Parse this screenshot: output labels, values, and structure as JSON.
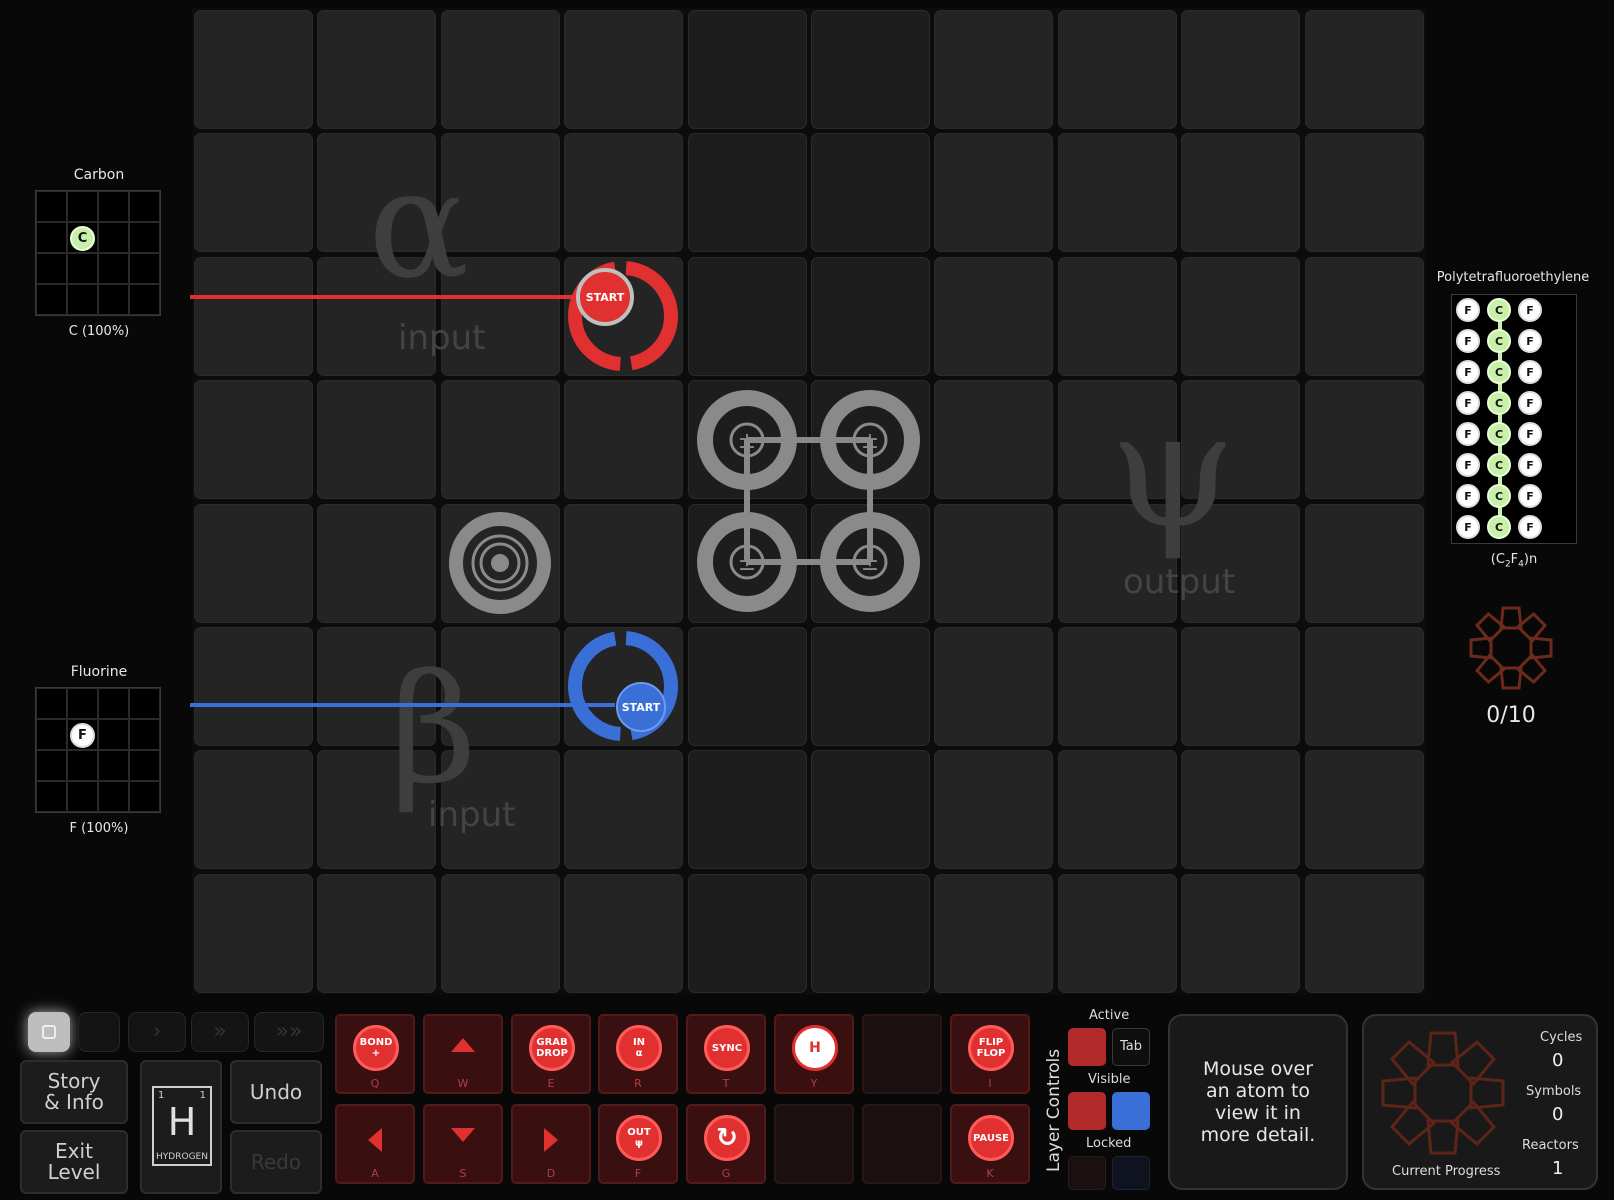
{
  "inputs": [
    {
      "name": "Carbon",
      "symbol": "C",
      "percent": "C (100%)"
    },
    {
      "name": "Fluorine",
      "symbol": "F",
      "percent": "F (100%)"
    }
  ],
  "zones": {
    "alpha": {
      "symbol": "α",
      "label": "input"
    },
    "beta": {
      "symbol": "β",
      "label": "input"
    },
    "psi": {
      "symbol": "ψ",
      "label": "output"
    }
  },
  "waldos": {
    "red_start": "START",
    "blue_start": "START"
  },
  "colors": {
    "red": "#e03030",
    "blue": "#3a6fd8",
    "carbon": "#c9f0a8",
    "fluorine": "#ffffff"
  },
  "output": {
    "name": "Polytetrafluoroethylene",
    "formula_base": "(C",
    "formula_sub1": "2",
    "formula_mid": "F",
    "formula_sub2": "4",
    "formula_tail": ")n",
    "progress": "0/10",
    "rows": [
      [
        "F",
        "C",
        "F"
      ],
      [
        "F",
        "C",
        "F"
      ],
      [
        "F",
        "C",
        "F"
      ],
      [
        "F",
        "C",
        "F"
      ],
      [
        "F",
        "C",
        "F"
      ],
      [
        "F",
        "C",
        "F"
      ],
      [
        "F",
        "C",
        "F"
      ],
      [
        "F",
        "C",
        "F"
      ]
    ]
  },
  "buttons": {
    "story_info": "Story\n& Info",
    "exit_level": "Exit\nLevel",
    "undo": "Undo",
    "redo": "Redo",
    "element_symbol": "H",
    "element_num_left": "1",
    "element_num_right": "1",
    "element_name": "HYDROGEN"
  },
  "tools_top": [
    {
      "label": "BOND\n+",
      "key": "Q"
    },
    {
      "label": "",
      "key": "W",
      "arrow": "up"
    },
    {
      "label": "GRAB\nDROP",
      "key": "E"
    },
    {
      "label": "IN\nα",
      "key": "R"
    },
    {
      "label": "SYNC",
      "key": "T"
    },
    {
      "label": "H",
      "key": "Y"
    },
    {
      "label": "",
      "key": ""
    },
    {
      "label": "FLIP\nFLOP",
      "key": "I"
    }
  ],
  "tools_bottom": [
    {
      "label": "",
      "key": "A",
      "arrow": "left"
    },
    {
      "label": "",
      "key": "S",
      "arrow": "down"
    },
    {
      "label": "",
      "key": "D",
      "arrow": "right"
    },
    {
      "label": "OUT\nψ",
      "key": "F"
    },
    {
      "label": "↻",
      "key": "G"
    },
    {
      "label": "",
      "key": ""
    },
    {
      "label": "",
      "key": ""
    },
    {
      "label": "PAUSE",
      "key": "K"
    }
  ],
  "layer_controls": {
    "title": "Layer Controls",
    "active": "Active",
    "tab": "Tab",
    "visible": "Visible",
    "locked": "Locked"
  },
  "info_box": "Mouse over\nan atom to\nview it in\nmore detail.",
  "stats": {
    "cycles_label": "Cycles",
    "cycles": "0",
    "symbols_label": "Symbols",
    "symbols": "0",
    "reactors_label": "Reactors",
    "reactors": "1",
    "progress_label": "Current Progress"
  }
}
